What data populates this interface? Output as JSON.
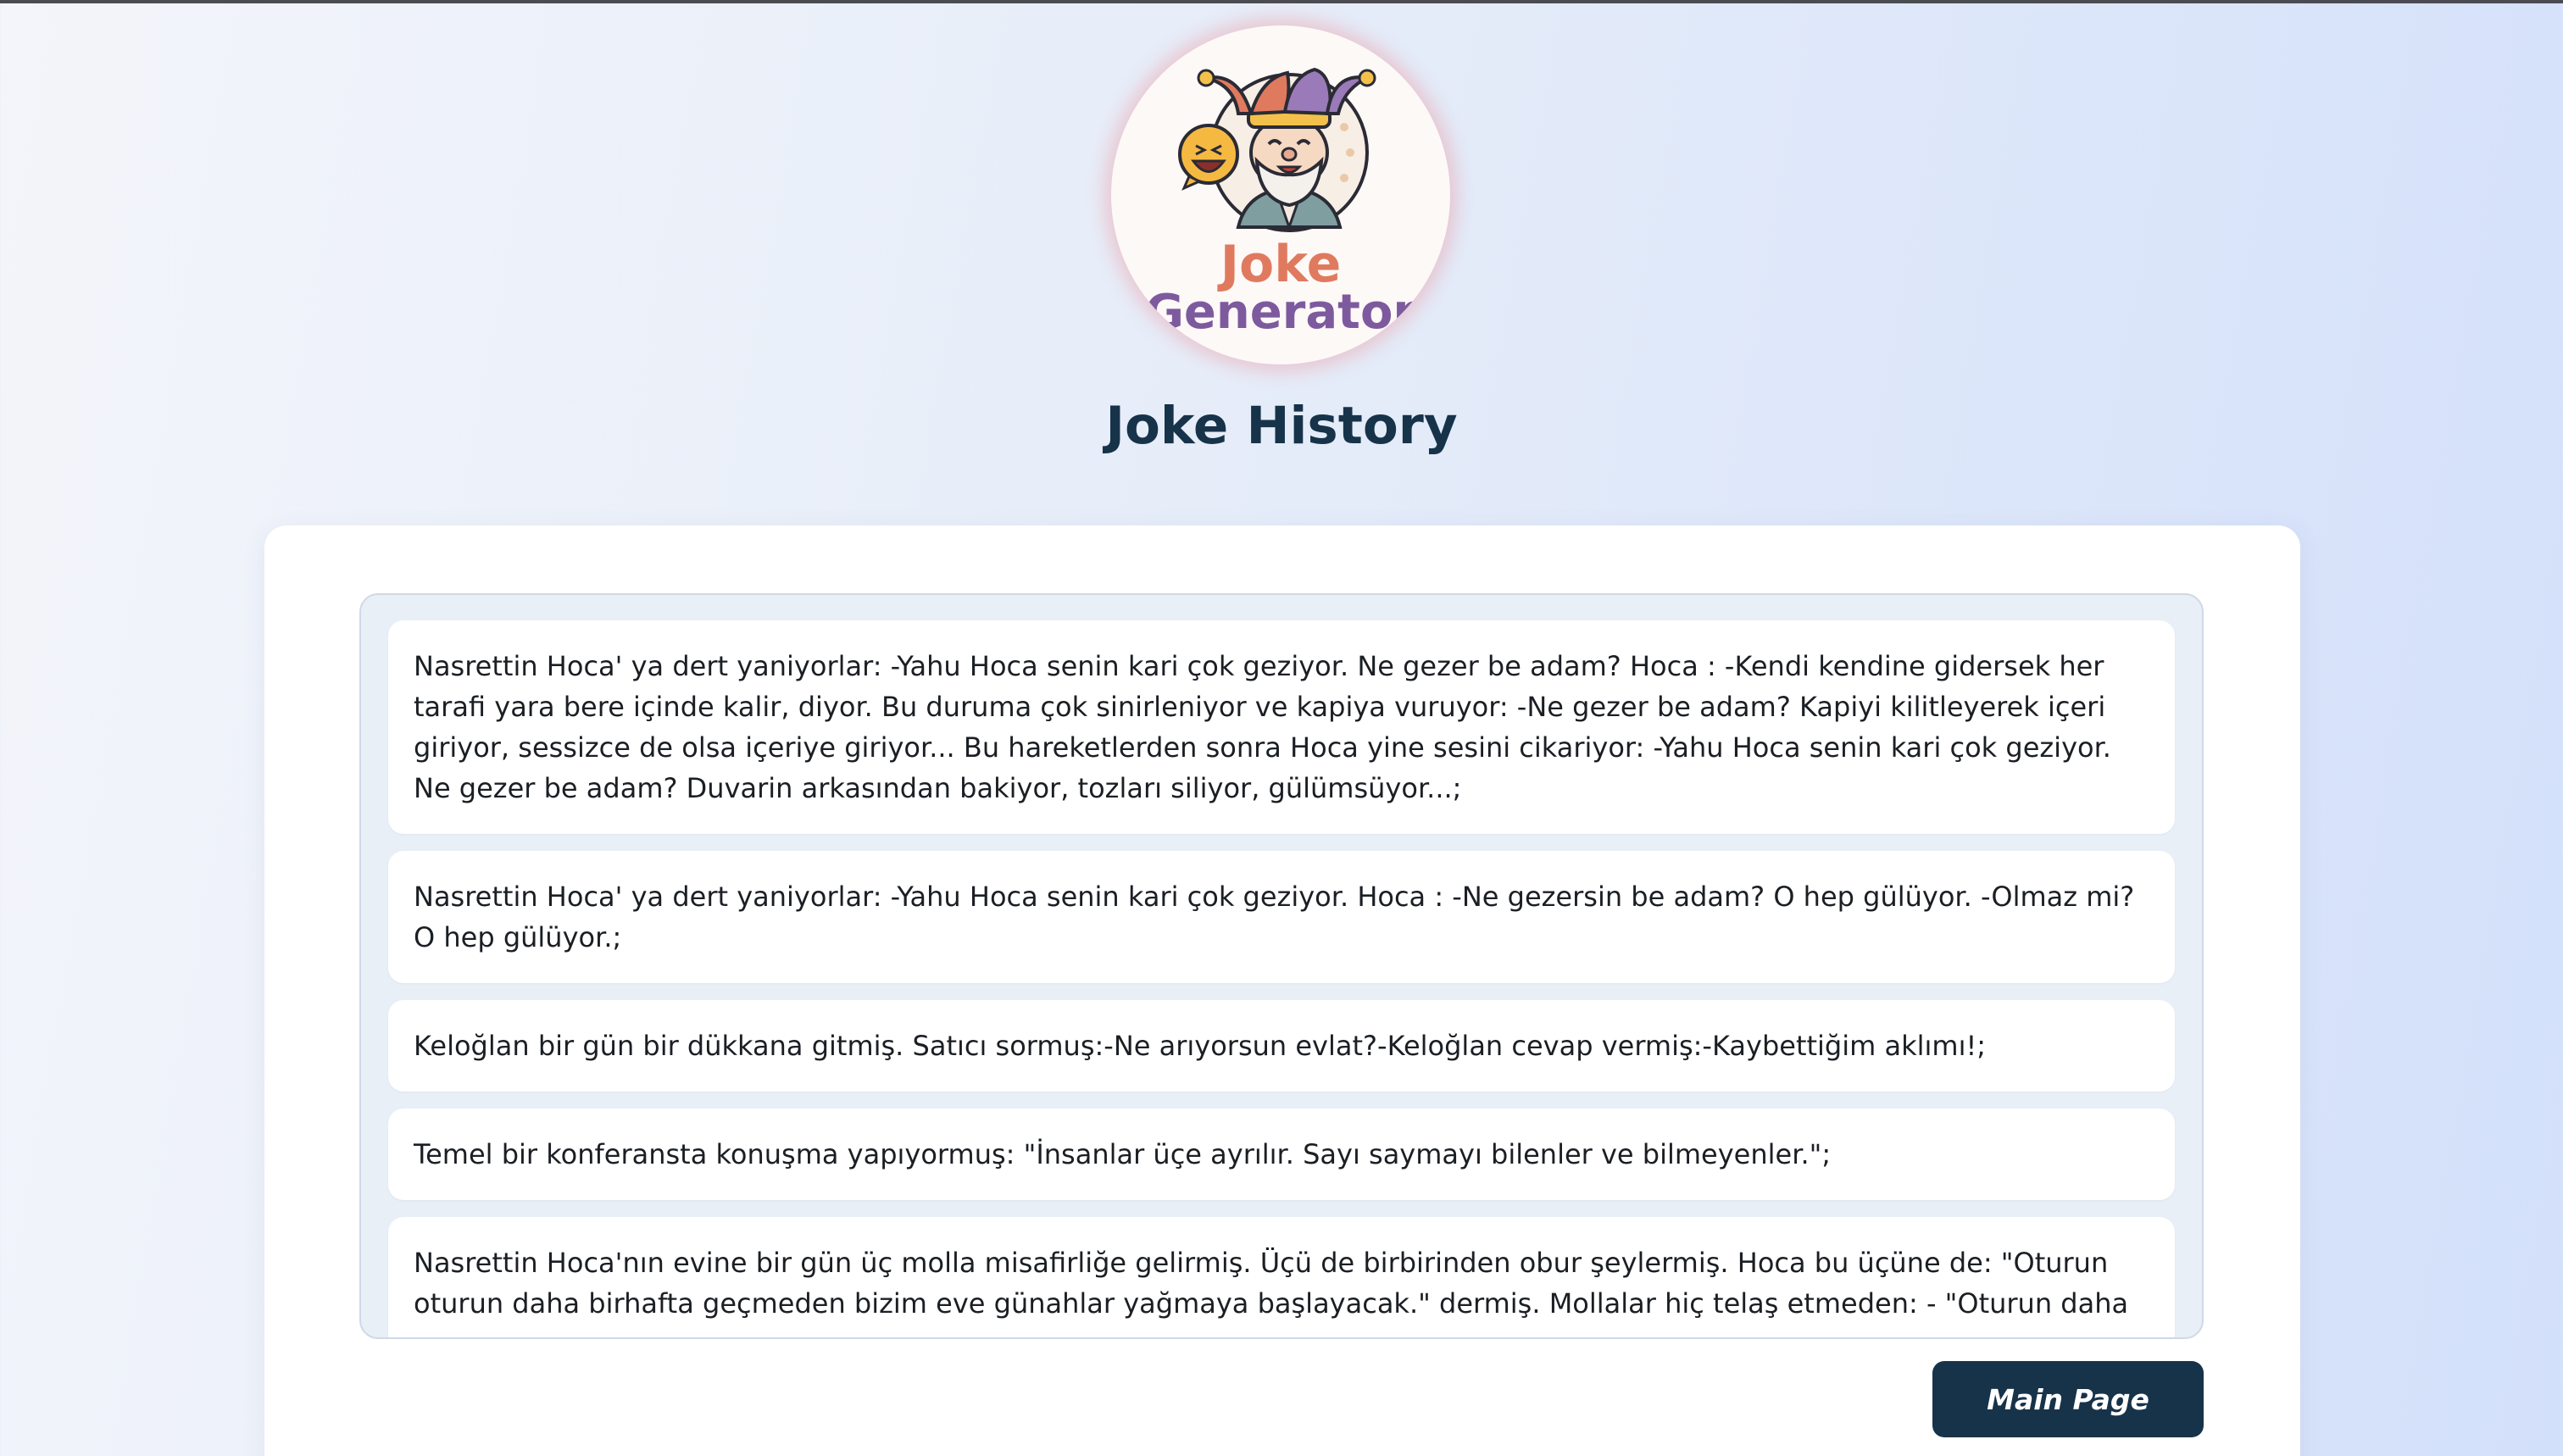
{
  "logo": {
    "line1": "Joke",
    "line2": "Generator",
    "colors": {
      "line1": "#e07a5f",
      "line2": "#7d5a9e",
      "hat_left": "#e07a5f",
      "hat_right": "#9a7ab8",
      "shirt": "#7f9ea0"
    },
    "icons": [
      "jester-hoca-icon",
      "laughing-emoji-icon"
    ]
  },
  "page": {
    "title": "Joke History"
  },
  "jokes": [
    {
      "text": "Nasrettin Hoca' ya dert yaniyorlar: -Yahu Hoca senin kari çok geziyor. Ne gezer be adam? Hoca : -Kendi kendine gidersek her tarafi yara bere içinde kalir, diyor. Bu duruma çok sinirleniyor ve kapiya vuruyor: -Ne gezer be adam? Kapiyi kilitleyerek içeri giriyor, sessizce de olsa içeriye giriyor... Bu hareketlerden sonra Hoca yine sesini cikariyor: -Yahu Hoca senin kari çok geziyor. Ne gezer be adam? Duvarin arkasından bakiyor, tozları siliyor, gülümsüyor...;"
    },
    {
      "text": "Nasrettin Hoca' ya dert yaniyorlar: -Yahu Hoca senin kari çok geziyor. Hoca : -Ne gezersin be adam? O hep gülüyor. -Olmaz mi? O hep gülüyor.;"
    },
    {
      "text": "Keloğlan bir gün bir dükkana gitmiş. Satıcı sormuş:-Ne arıyorsun evlat?-Keloğlan cevap vermiş:-Kaybettiğim aklımı!;"
    },
    {
      "text": "Temel bir konferansta konuşma yapıyormuş: \"İnsanlar üçe ayrılır. Sayı saymayı bilenler ve bilmeyenler.\";"
    },
    {
      "text": "Nasrettin Hoca'nın evine bir gün üç molla misafirliğe gelirmiş. Üçü de birbirinden obur şeylermiş. Hoca bu üçüne de: \"Oturun oturun daha birhafta geçmeden bizim eve günahlar yağmaya başlayacak.\" dermiş. Mollalar hiç telaş etmeden: - \"Oturun daha"
    }
  ],
  "actions": {
    "main_page": "Main Page"
  },
  "colors": {
    "accent": "#17334a",
    "card": "#ffffff",
    "list_bg": "#e9eff7"
  }
}
